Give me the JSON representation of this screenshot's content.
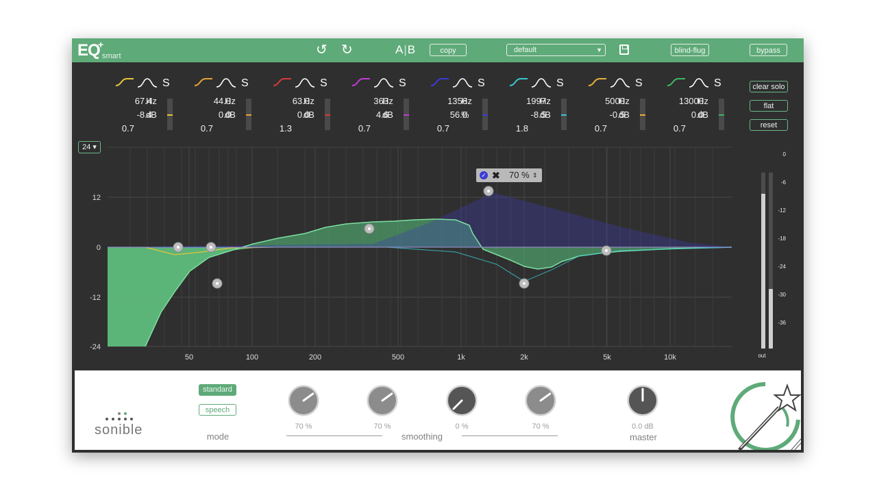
{
  "header": {
    "logo_main": "EQ",
    "logo_plus": "+",
    "logo_sub": "smart",
    "ab_a": "A",
    "ab_b": "B",
    "copy_label": "copy",
    "preset_value": "default",
    "blind_flug_label": "blind-flug",
    "bypass_label": "bypass"
  },
  "bands": [
    {
      "freq": "67.4",
      "freq_unit": "Hz",
      "gain": "-8.4",
      "gain_unit": "dB",
      "q": "0.7",
      "color": "#e8c53c",
      "solo": "S",
      "level": 0.5
    },
    {
      "freq": "44.0",
      "freq_unit": "Hz",
      "gain": "0.0",
      "gain_unit": "dB",
      "q": "0.7",
      "color": "#e6a33a",
      "solo": "S",
      "level": 0.5
    },
    {
      "freq": "63.0",
      "freq_unit": "Hz",
      "gain": "0.0",
      "gain_unit": "dB",
      "q": "1.3",
      "color": "#d83a3a",
      "solo": "S",
      "level": 0.5
    },
    {
      "freq": "363",
      "freq_unit": "Hz",
      "gain": "4.6",
      "gain_unit": "dB",
      "q": "0.7",
      "color": "#c33ad6",
      "solo": "S",
      "level": 0.5
    },
    {
      "freq": "1356",
      "freq_unit": "Hz",
      "gain": "56.0",
      "gain_unit": "%",
      "q": "0.7",
      "color": "#3b3bd6",
      "solo": "S",
      "level": 0.5
    },
    {
      "freq": "1997",
      "freq_unit": "Hz",
      "gain": "-8.5",
      "gain_unit": "dB",
      "q": "1.8",
      "color": "#3ac8d0",
      "solo": "S",
      "level": 0.5
    },
    {
      "freq": "5000",
      "freq_unit": "Hz",
      "gain": "-0.5",
      "gain_unit": "dB",
      "q": "0.7",
      "color": "#e8b03c",
      "solo": "S",
      "level": 0.5
    },
    {
      "freq": "13000",
      "freq_unit": "Hz",
      "gain": "0.0",
      "gain_unit": "dB",
      "q": "0.7",
      "color": "#3cb860",
      "solo": "S",
      "level": 0.5
    }
  ],
  "side_buttons": {
    "clear_solo": "clear solo",
    "flat": "flat",
    "reset": "reset"
  },
  "range_select": "24 ▾",
  "graph": {
    "db_ticks": [
      "12",
      "0",
      "-12",
      "-24"
    ],
    "freq_ticks": [
      "50",
      "100",
      "200",
      "500",
      "1k",
      "2k",
      "5k",
      "10k"
    ],
    "popup_value": "70 %"
  },
  "meter": {
    "ticks": [
      "0",
      "-6",
      "-12",
      "-18",
      "-24",
      "-30",
      "-36"
    ],
    "label": "out",
    "left_level": 0.88,
    "right_level": 0.34
  },
  "bottom": {
    "brand": "sonible",
    "mode_standard": "standard",
    "mode_speech": "speech",
    "mode_label": "mode",
    "smoothing_label": "smoothing",
    "master_label": "master",
    "knobs": [
      {
        "value": "70 %",
        "level": 0.7
      },
      {
        "value": "70 %",
        "level": 0.7
      },
      {
        "value": "0 %",
        "level": 0.0
      },
      {
        "value": "70 %",
        "level": 0.7
      },
      {
        "value": "0.0 dB",
        "level": 0.5
      }
    ]
  },
  "colors": {
    "accent": "#5faa79",
    "panel": "#2f2f2f"
  }
}
